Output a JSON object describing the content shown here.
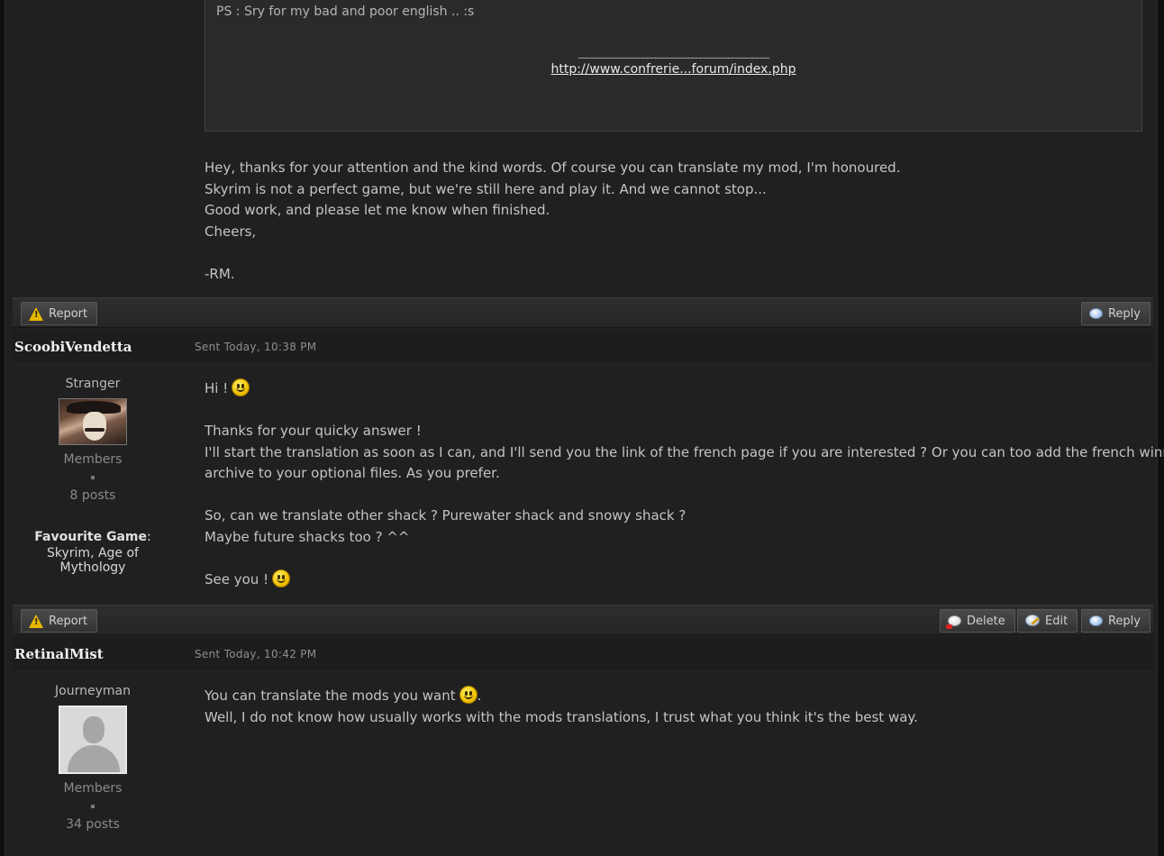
{
  "post1": {
    "quote_ps": "PS : Sry for my bad and poor english .. :s",
    "signature_line": "_______________________________________________",
    "signature_link": "http://www.confrerie...forum/index.php",
    "lines": [
      "Hey, thanks for your attention and the kind words. Of course you can translate my mod, I'm honoured.",
      "Skyrim is not a perfect game, but we're still here and play it. And we cannot stop...",
      "Good work, and please let me know when finished.",
      "Cheers,",
      "",
      "-RM."
    ],
    "report_label": "Report",
    "reply_label": "Reply"
  },
  "post2": {
    "author": "ScoobiVendetta",
    "sent": "Sent Today, 10:38 PM",
    "rank": "Stranger",
    "group": "Members",
    "posts": "8 posts",
    "fav_label": "Favourite Game",
    "fav_colon": ":",
    "fav_value": "Skyrim, Age of Mythology",
    "line_hi": "Hi !",
    "line_thanks": "Thanks for your quicky answer !",
    "line_start_1": "I'll start the translation as soon as I can, and I'll send you the link of the french page if you are interested ? Or you can too add the french winrar",
    "line_start_2": "archive to your optional files. As you prefer.",
    "line_so": "So, can we translate other shack ? Purewater shack and snowy shack ?",
    "line_maybe": "Maybe future shacks too ? ^^",
    "line_see": "See you !",
    "report_label": "Report",
    "delete_label": "Delete",
    "edit_label": "Edit",
    "reply_label": "Reply"
  },
  "post3": {
    "author": "RetinalMist",
    "sent": "Sent Today, 10:42 PM",
    "rank": "Journeyman",
    "group": "Members",
    "posts": "34 posts",
    "line_1": "You can translate the mods you want",
    "line_1_end": ".",
    "line_2": "Well, I do not know how usually works with the mods translations, I trust what you think it's the best way."
  }
}
